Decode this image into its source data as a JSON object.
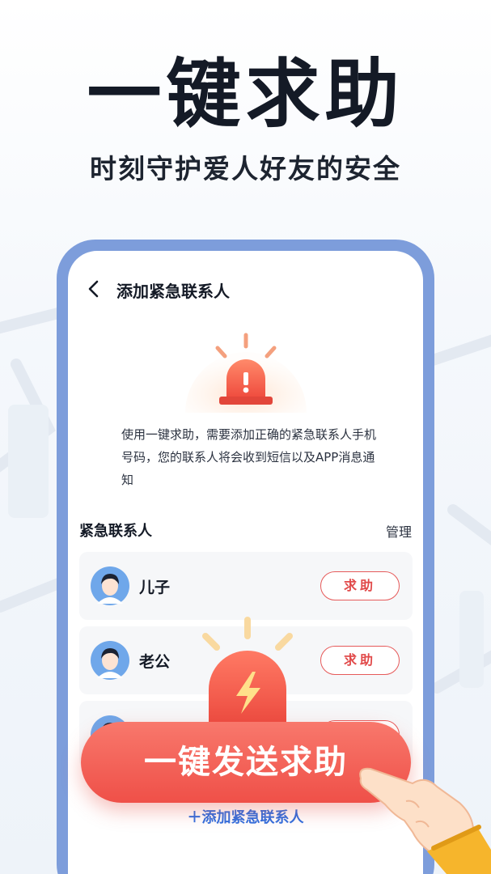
{
  "hero": {
    "title": "一键求助",
    "subtitle": "时刻守护爱人好友的安全"
  },
  "screen": {
    "nav_title": "添加紧急联系人",
    "description": "使用一键求助，需要添加正确的紧急联系人手机号码，您的联系人将会收到短信以及APP消息通知",
    "section_title": "紧急联系人",
    "manage_label": "管理",
    "contacts": [
      {
        "name": "儿子",
        "button": "求助"
      },
      {
        "name": "老公",
        "button": "求助"
      },
      {
        "name": "",
        "button": "求助"
      }
    ],
    "add_contact_label": "＋添加紧急联系人"
  },
  "sos_button_label": "一键发送求助",
  "colors": {
    "accent_red": "#ef5048",
    "link_blue": "#2f6fe0",
    "phone_frame": "#7d9ddb"
  },
  "icons": [
    "back-icon",
    "alarm-light-icon",
    "avatar-icon",
    "lightning-alarm-icon",
    "pointing-hand-icon"
  ]
}
